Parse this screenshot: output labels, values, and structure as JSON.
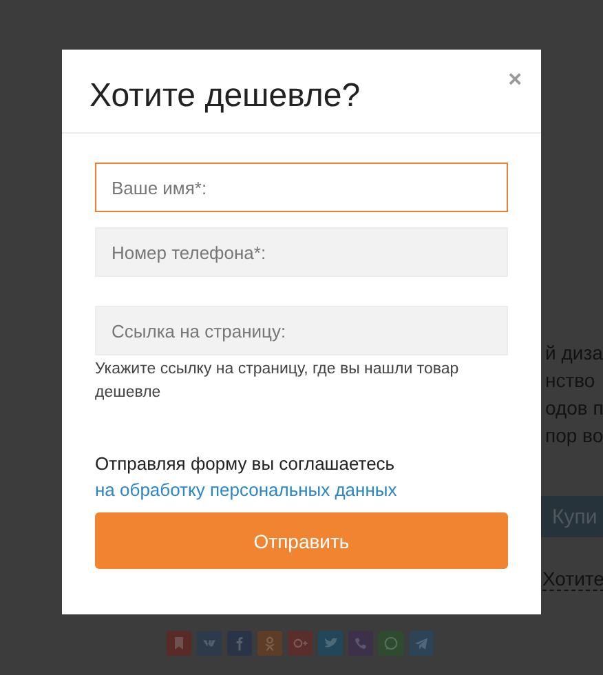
{
  "background_page": {
    "text_fragments": [
      "й диза",
      "нство",
      "одов п",
      "пор во"
    ],
    "buy_button": "Купи",
    "cheaper_link": "Хотите",
    "share_buttons": [
      {
        "kind": "bookmark",
        "color": "#5a2a27"
      },
      {
        "kind": "vk",
        "color": "#2c3a4a"
      },
      {
        "kind": "facebook",
        "color": "#2b3447"
      },
      {
        "kind": "odnoklassniki",
        "color": "#5e3d27"
      },
      {
        "kind": "googleplus",
        "color": "#5a2e2a"
      },
      {
        "kind": "twitter",
        "color": "#23475a"
      },
      {
        "kind": "viber",
        "color": "#3c3148"
      },
      {
        "kind": "whatsapp",
        "color": "#2e4a2f"
      },
      {
        "kind": "telegram",
        "color": "#2c4456"
      }
    ]
  },
  "modal": {
    "title": "Хотите дешевле?",
    "close": "×",
    "fields": [
      {
        "placeholder": "Ваше имя*:",
        "focused": true
      },
      {
        "placeholder": "Номер телефона*:",
        "focused": false
      },
      {
        "placeholder": "Ссылка на страницу:",
        "focused": false
      }
    ],
    "hint": "Укажите ссылку на страницу, где вы нашли товар дешевле",
    "consent_text": "Отправляя форму вы соглашаетесь",
    "consent_link": "на обработку персональных данных",
    "submit": "Отправить"
  }
}
